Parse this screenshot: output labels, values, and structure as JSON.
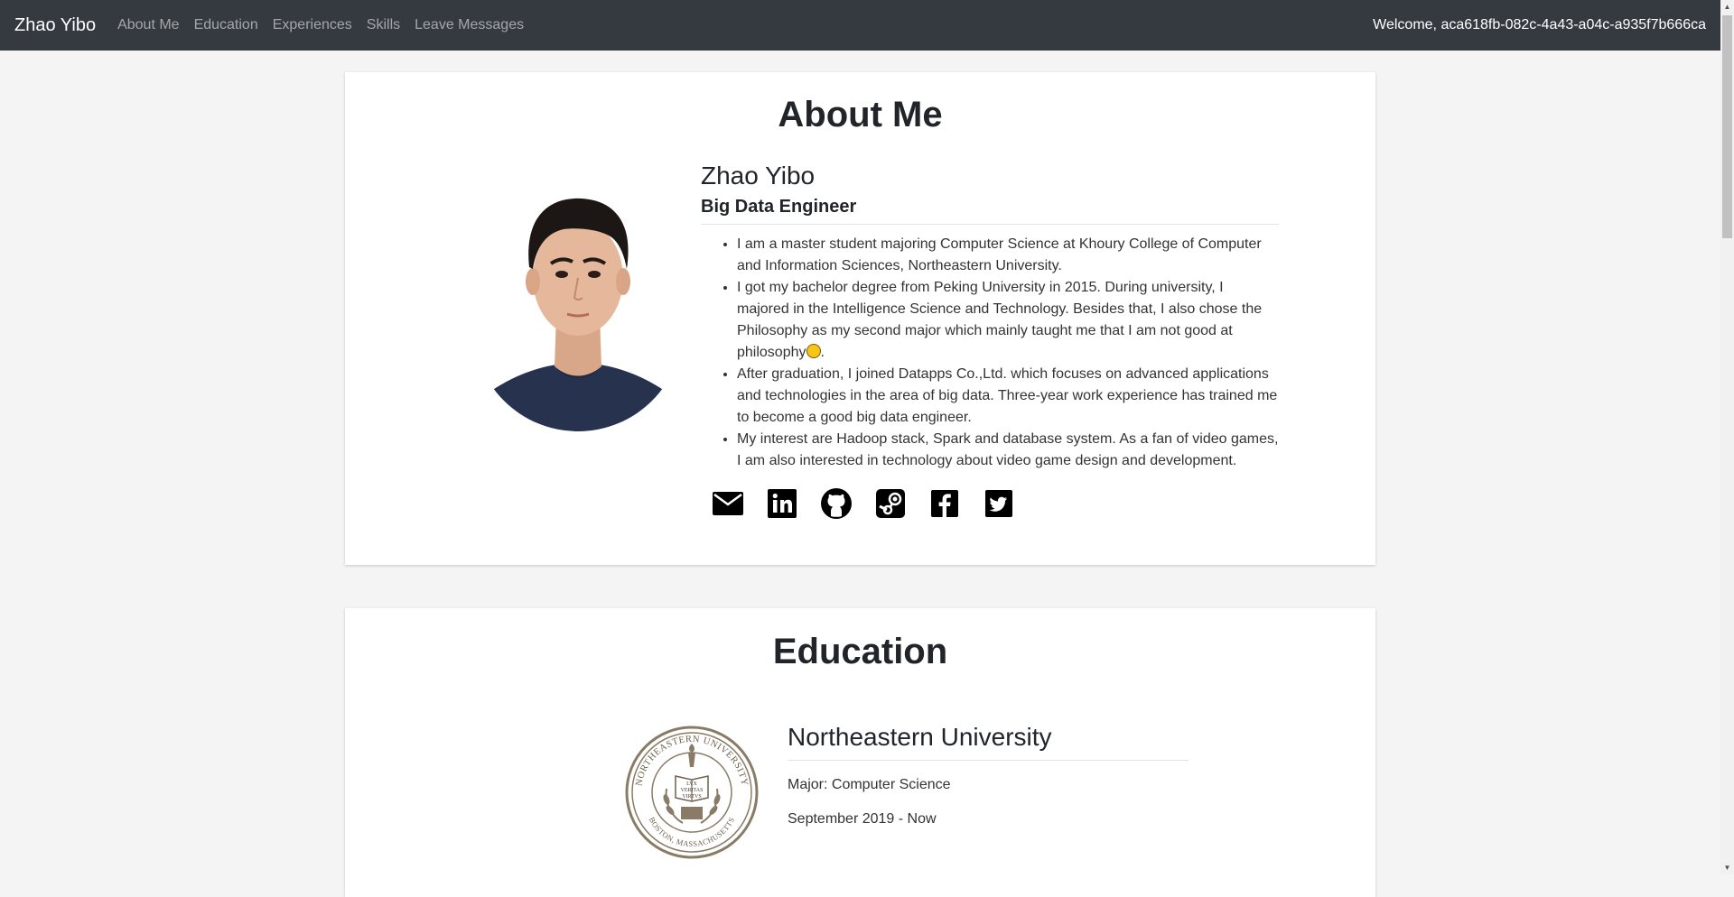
{
  "navbar": {
    "brand": "Zhao Yibo",
    "links": [
      "About Me",
      "Education",
      "Experiences",
      "Skills",
      "Leave Messages"
    ],
    "welcome": "Welcome, aca618fb-082c-4a43-a04c-a935f7b666ca"
  },
  "about": {
    "title": "About Me",
    "name": "Zhao Yibo",
    "role": "Big Data Engineer",
    "bio": [
      "I am a master student majoring Computer Science at Khoury College of Computer and Information Sciences, Northeastern University.",
      "I got my bachelor degree from Peking University in 2015. During university, I majored in the Intelligence Science and Technology. Besides that, I also chose the Philosophy as my second major which mainly taught me that I am not good at philosophy",
      "After graduation, I joined Datapps Co.,Ltd. which focuses on advanced applications and technologies in the area of big data. Three-year work experience has trained me to become a good big data engineer.",
      "My interest are Hadoop stack, Spark and database system. As a fan of video games, I am also interested in technology about video game design and development."
    ],
    "bio_suffix": ".",
    "socials": [
      "email-icon",
      "linkedin-icon",
      "github-icon",
      "steam-icon",
      "facebook-icon",
      "twitter-icon"
    ]
  },
  "education": {
    "title": "Education",
    "school": "Northeastern University",
    "major": "Major: Computer Science",
    "period": "September 2019 - Now",
    "seal_text": {
      "ring": "NORTHEASTERN UNIVERSITY",
      "bottom": "BOSTON, MASSACHUSETTS",
      "motto": [
        "LVX",
        "VERITAS",
        "VIRTVS"
      ]
    }
  },
  "colors": {
    "navbar_bg": "#343a40",
    "page_bg": "#f4f4f4",
    "card_bg": "#ffffff",
    "seal": "#8a7b66"
  }
}
